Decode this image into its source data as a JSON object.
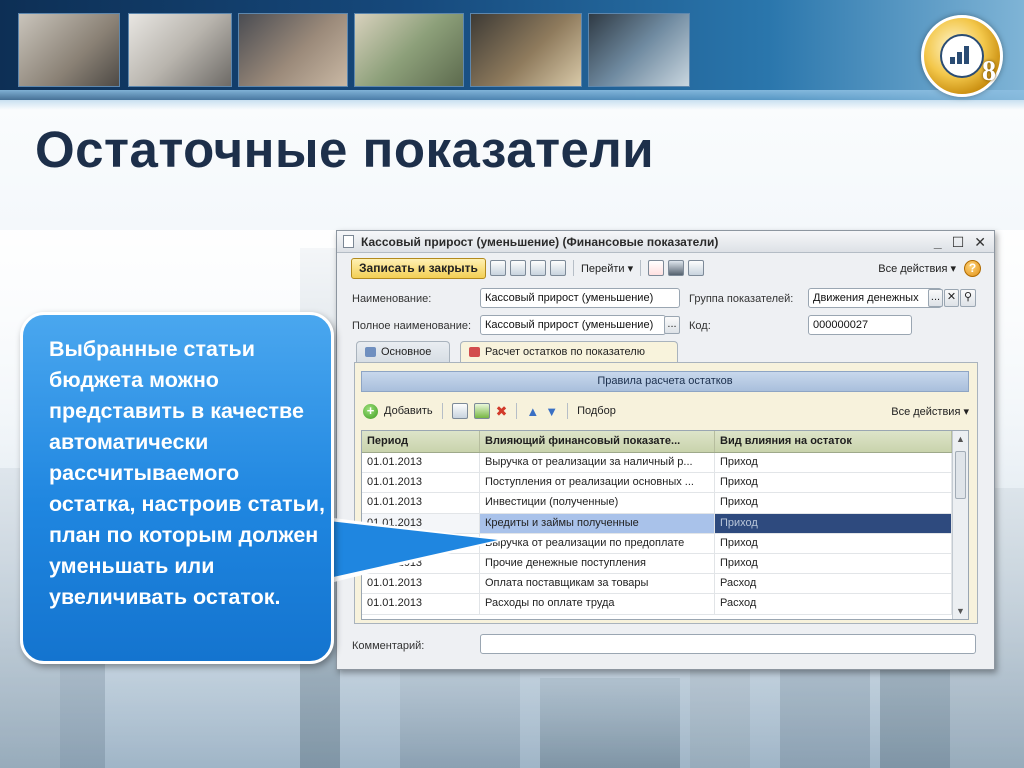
{
  "slide": {
    "title": "Остаточные показатели",
    "callout_text": "Выбранные статьи бюджета можно представить в качестве автоматически рассчитываемого остатка, настроив статьи, план по которым должен уменьшать или увеличивать остаток.",
    "logo_number": "8"
  },
  "window": {
    "title": "Кассовый прирост (уменьшение) (Финансовые показатели)",
    "controls": [
      "_",
      "☐",
      "✕"
    ],
    "toolbar": {
      "save_close": "Записать и закрыть",
      "goto": "Перейти ▾",
      "all_actions": "Все действия ▾",
      "help": "?"
    },
    "fields": {
      "name_label": "Наименование:",
      "name_value": "Кассовый прирост (уменьшение)",
      "full_name_label": "Полное наименование:",
      "full_name_value": "Кассовый прирост (уменьшение)",
      "group_label": "Группа показателей:",
      "group_value": "Движения денежных",
      "code_label": "Код:",
      "code_value": "000000027",
      "ellipsis": "...",
      "clear": "✕"
    },
    "tabs": [
      {
        "label": "Основное"
      },
      {
        "label": "Расчет остатков по показателю"
      }
    ],
    "rules": {
      "header": "Правила расчета остатков",
      "add": "Добавить",
      "select": "Подбор",
      "all_actions": "Все действия ▾",
      "columns": [
        "Период",
        "Влияющий финансовый показате...",
        "Вид влияния на остаток"
      ],
      "rows": [
        {
          "period": "01.01.2013",
          "indicator": "Выручка от реализации за наличный р...",
          "effect": "Приход"
        },
        {
          "period": "01.01.2013",
          "indicator": "Поступления от реализации основных ...",
          "effect": "Приход"
        },
        {
          "period": "01.01.2013",
          "indicator": "Инвестиции (полученные)",
          "effect": "Приход"
        },
        {
          "period": "01.01.2013",
          "indicator": "Кредиты и займы полученные",
          "effect": "Приход"
        },
        {
          "period": "01.01.2013",
          "indicator": "Выручка от реализации по предоплате",
          "effect": "Приход"
        },
        {
          "period": "01.01.2013",
          "indicator": "Прочие денежные поступления",
          "effect": "Приход"
        },
        {
          "period": "01.01.2013",
          "indicator": "Оплата поставщикам за товары",
          "effect": "Расход"
        },
        {
          "period": "01.01.2013",
          "indicator": "Расходы по оплате труда",
          "effect": "Расход"
        }
      ]
    },
    "comment_label": "Комментарий:"
  },
  "colors": {
    "title_text": "#1d2f4a",
    "callout_fill": "#1f86e0",
    "save_button": "#f3cf55",
    "selected_row": "#2e4a7e"
  }
}
